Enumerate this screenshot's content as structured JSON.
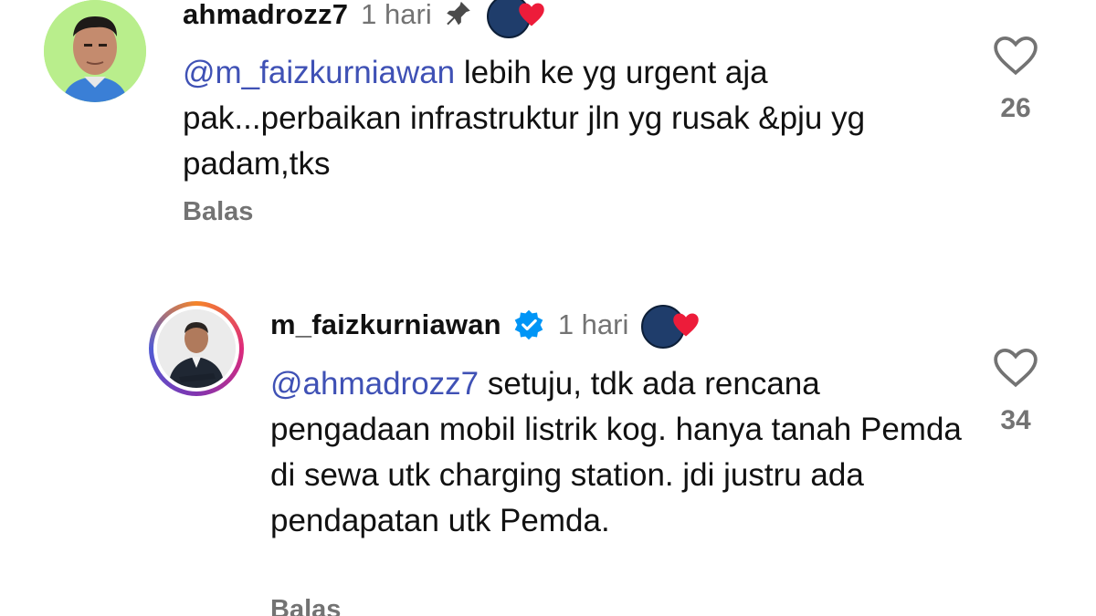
{
  "comments": [
    {
      "username": "ahmadrozz7",
      "time": "1 hari",
      "pinned": true,
      "verified": false,
      "mention": "@m_faizkurniawan",
      "text_after_mention": " lebih ke yg urgent aja pak...perbaikan infrastruktur jln yg rusak &pju yg padam,tks",
      "reply_label": "Balas",
      "like_count": "26"
    },
    {
      "username": "m_faizkurniawan",
      "time": "1 hari",
      "pinned": false,
      "verified": true,
      "mention": "@ahmadrozz7",
      "text_after_mention": " setuju, tdk ada rencana pengadaan mobil listrik kog. hanya tanah Pemda di sewa utk charging station. jdi justru ada pendapatan utk Pemda.",
      "reply_label": "Balas",
      "like_count": "34"
    }
  ],
  "colors": {
    "mention": "#3f51b5",
    "secondary_text": "#737373",
    "verified_blue": "#0095f6",
    "heart_red": "#ed1c3a"
  },
  "icons": [
    "pin-icon",
    "verified-badge-icon",
    "creator-liked-heart-icon",
    "like-heart-outline-icon"
  ]
}
